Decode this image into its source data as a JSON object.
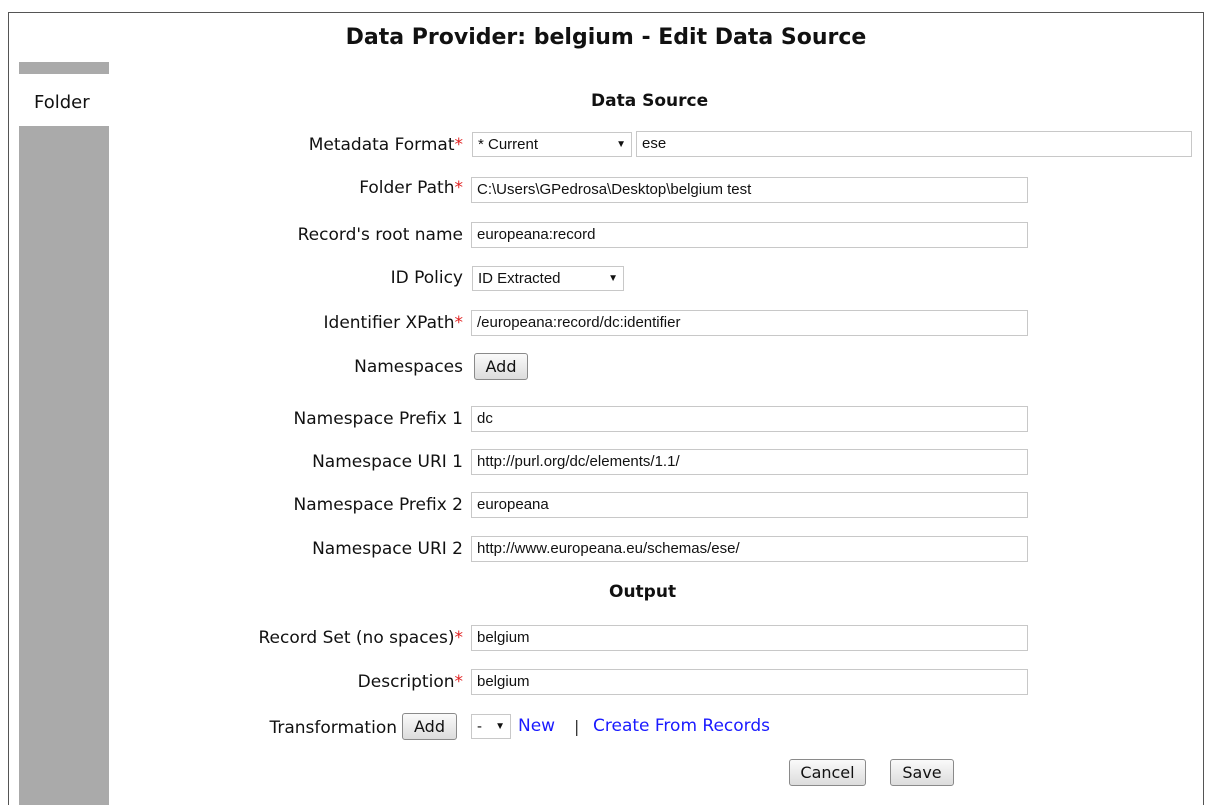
{
  "window": {
    "title": "Data Provider: belgium - Edit Data Source"
  },
  "sidebar": {
    "active_tab": "Folder"
  },
  "sections": {
    "data_source": "Data Source",
    "output": "Output"
  },
  "form": {
    "metadata_format": {
      "label": "Metadata Format",
      "select_value": "* Current",
      "value": "ese"
    },
    "folder_path": {
      "label": "Folder Path",
      "value": "C:\\Users\\GPedrosa\\Desktop\\belgium test"
    },
    "record_root": {
      "label": "Record's root name",
      "value": "europeana:record"
    },
    "id_policy": {
      "label": "ID Policy",
      "value": "ID Extracted"
    },
    "identifier_xpath": {
      "label": "Identifier XPath",
      "value": "/europeana:record/dc:identifier"
    },
    "namespaces": {
      "label": "Namespaces",
      "add_label": "Add"
    },
    "ns_prefix_1": {
      "label": "Namespace Prefix 1",
      "value": "dc"
    },
    "ns_uri_1": {
      "label": "Namespace URI 1",
      "value": "http://purl.org/dc/elements/1.1/"
    },
    "ns_prefix_2": {
      "label": "Namespace Prefix 2",
      "value": "europeana"
    },
    "ns_uri_2": {
      "label": "Namespace URI 2",
      "value": "http://www.europeana.eu/schemas/ese/"
    },
    "record_set": {
      "label": "Record Set (no spaces)",
      "value": "belgium"
    },
    "description": {
      "label": "Description",
      "value": "belgium"
    },
    "transformation": {
      "label": "Transformation",
      "add_label": "Add",
      "select_value": "-",
      "new_link": "New",
      "separator": "|",
      "create_link": "Create From Records"
    }
  },
  "required_marker": "*",
  "actions": {
    "cancel": "Cancel",
    "save": "Save"
  },
  "icons": {
    "dropdown": "chevron-down-icon"
  },
  "colors": {
    "required": "#e02020",
    "link": "#1a1aff",
    "sidebar": "#aaaaaa"
  }
}
